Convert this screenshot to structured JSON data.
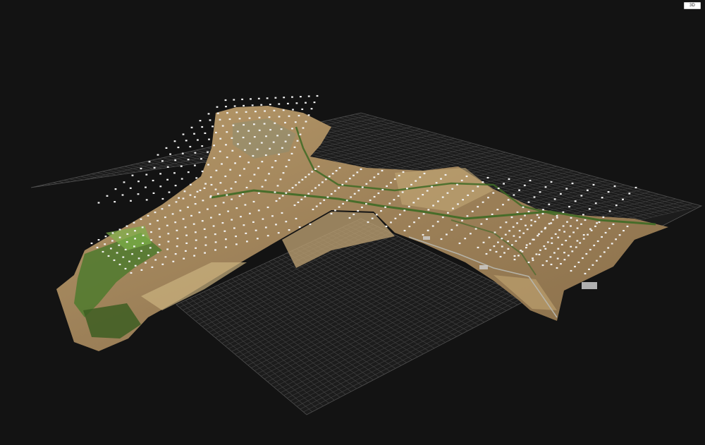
{
  "viewer": {
    "view_mode_label": "3D"
  },
  "colors": {
    "background": "#131313",
    "grid": "#4a4a4a",
    "terrain": "#a1865a",
    "terrain_light": "#c3a877",
    "vegetation": "#4f7a2e",
    "vegetation_bright": "#7fb24a",
    "camera_marker": "#f2f2f2"
  },
  "icons": {
    "camera_marker": "camera-position-icon"
  }
}
